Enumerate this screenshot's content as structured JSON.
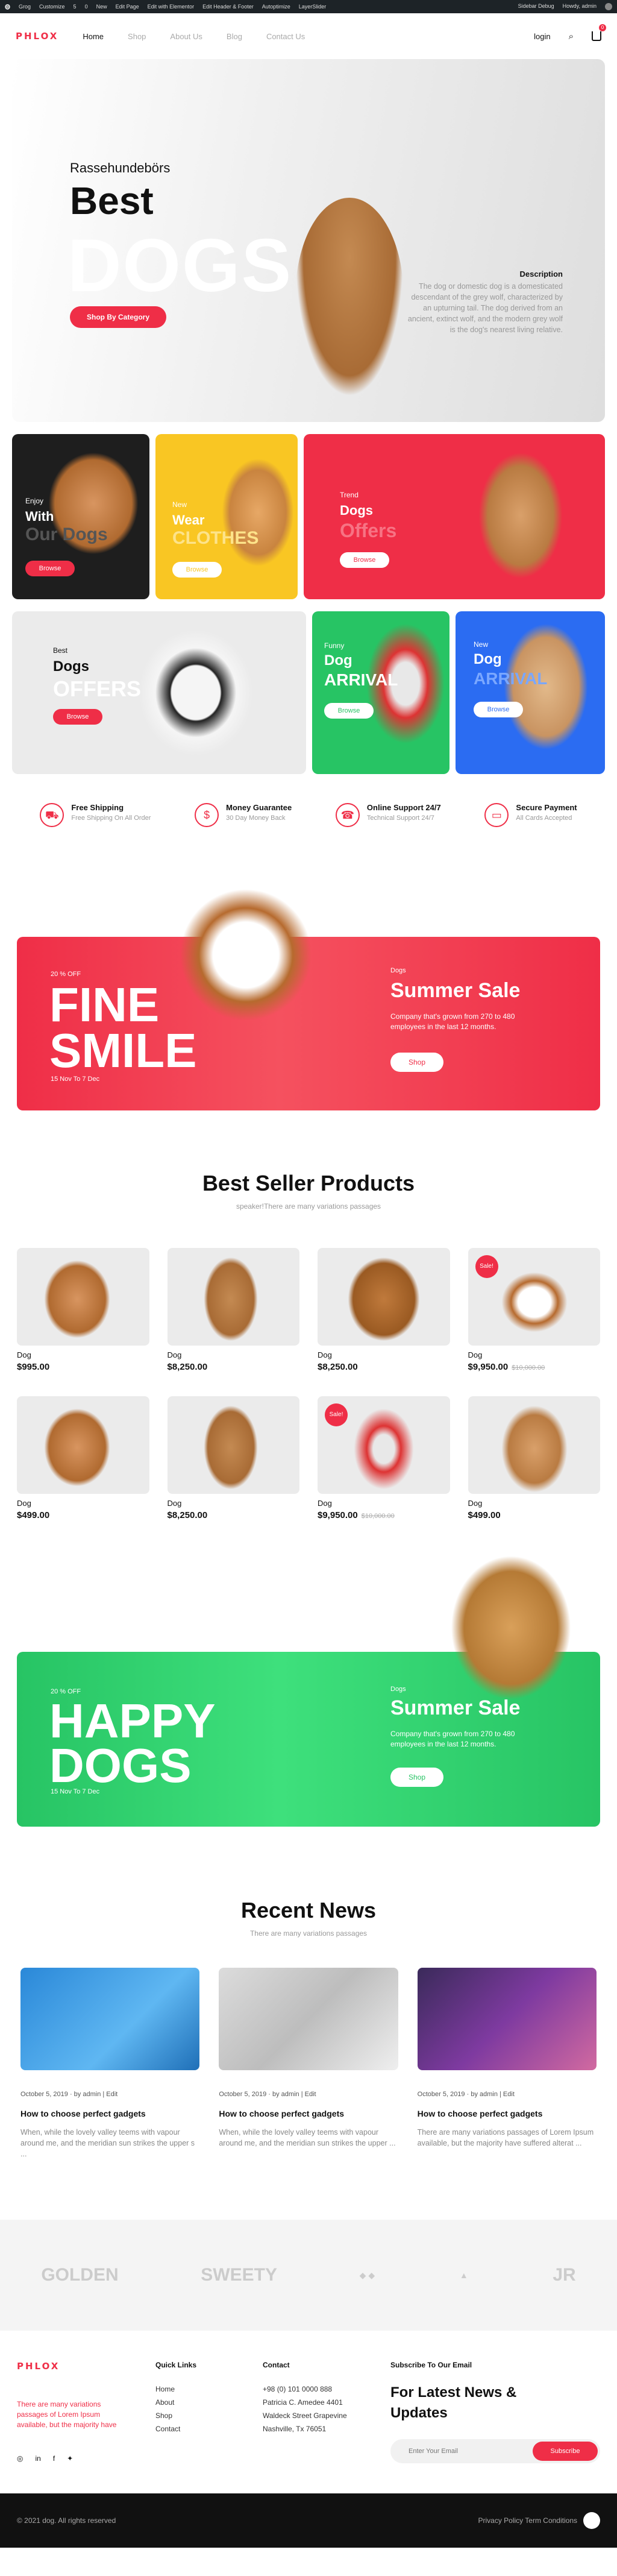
{
  "admin_bar": {
    "items": [
      "Grog",
      "Customize",
      "5",
      "0",
      "New",
      "Edit Page",
      "Edit with Elementor",
      "Edit Header & Footer",
      "Autoptimize",
      "LayerSlider"
    ],
    "right": [
      "Sidebar Debug",
      "Howdy, admin"
    ]
  },
  "header": {
    "logo": "PHLOX",
    "nav": [
      "Home",
      "Shop",
      "About Us",
      "Blog",
      "Contact Us"
    ],
    "login": "login",
    "cart_count": "0"
  },
  "hero": {
    "pretitle": "Rassehundebörs",
    "title": "Best",
    "big": "DOGS",
    "button": "Shop By Category",
    "desc_title": "Description",
    "desc": "The dog or domestic dog is a domesticated descendant of the grey wolf, characterized by an upturning tail. The dog derived from an ancient, extinct wolf, and the modern grey wolf is the dog's nearest living relative."
  },
  "cards_row1": [
    {
      "small": "Enjoy",
      "big": "With",
      "outline": "Our Dogs",
      "button": "Browse"
    },
    {
      "small": "New",
      "big": "Wear",
      "outline": "CLOTHES",
      "button": "Browse"
    },
    {
      "small": "Trend",
      "big": "Dogs",
      "outline": "Offers",
      "button": "Browse"
    }
  ],
  "cards_row2": [
    {
      "small": "Best",
      "big": "Dogs",
      "outline": "OFFERS",
      "button": "Browse"
    },
    {
      "small": "Funny",
      "big": "Dog",
      "outline": "ARRIVAL",
      "button": "Browse"
    },
    {
      "small": "New",
      "big": "Dog",
      "outline": "ARRIVAL",
      "button": "Browse"
    }
  ],
  "features": [
    {
      "title": "Free Shipping",
      "sub": "Free Shipping On All Order",
      "icon": "truck-icon"
    },
    {
      "title": "Money Guarantee",
      "sub": "30 Day Money Back",
      "icon": "money-icon"
    },
    {
      "title": "Online Support 24/7",
      "sub": "Technical Support 24/7",
      "icon": "headset-icon"
    },
    {
      "title": "Secure Payment",
      "sub": "All Cards Accepted",
      "icon": "card-icon"
    }
  ],
  "sale1": {
    "pct": "20 % OFF",
    "w1": "FINE",
    "w2": "SMILE",
    "date": "15 Nov To 7 Dec",
    "small": "Dogs",
    "title": "Summer Sale",
    "text": "Company that's grown from 270 to 480 employees in the last 12 months.",
    "button": "Shop"
  },
  "best": {
    "title": "Best Seller Products",
    "sub": "speaker!There are many variations passages"
  },
  "products": [
    {
      "name": "Dog",
      "price": "$995.00",
      "old": "",
      "badge": ""
    },
    {
      "name": "Dog",
      "price": "$8,250.00",
      "old": "",
      "badge": ""
    },
    {
      "name": "Dog",
      "price": "$8,250.00",
      "old": "",
      "badge": ""
    },
    {
      "name": "Dog",
      "price": "$9,950.00",
      "old": "$10,000.00",
      "badge": "Sale!"
    },
    {
      "name": "Dog",
      "price": "$499.00",
      "old": "",
      "badge": ""
    },
    {
      "name": "Dog",
      "price": "$8,250.00",
      "old": "",
      "badge": ""
    },
    {
      "name": "Dog",
      "price": "$9,950.00",
      "old": "$10,000.00",
      "badge": "Sale!"
    },
    {
      "name": "Dog",
      "price": "$499.00",
      "old": "",
      "badge": ""
    }
  ],
  "sale2": {
    "pct": "20 % OFF",
    "w1": "HAPPY",
    "w2": "DOGS",
    "date": "15 Nov To 7 Dec",
    "small": "Dogs",
    "title": "Summer Sale",
    "text": "Company that's grown from 270 to 480 employees in the last 12 months.",
    "button": "Shop"
  },
  "news": {
    "title": "Recent News",
    "sub": "There are many variations passages",
    "items": [
      {
        "date": "October 5, 2019",
        "by": "by admin | Edit",
        "title": "How to choose perfect gadgets",
        "text": "When, while the lovely valley teems with vapour around me, and the meridian sun strikes the upper s ..."
      },
      {
        "date": "October 5, 2019",
        "by": "by admin | Edit",
        "title": "How to choose perfect gadgets",
        "text": "When, while the lovely valley teems with vapour around me, and the meridian sun strikes the upper ..."
      },
      {
        "date": "October 5, 2019",
        "by": "by admin | Edit",
        "title": "How to choose perfect gadgets",
        "text": "There are many variations passages of Lorem Ipsum available, but the majority have suffered alterat ..."
      }
    ]
  },
  "brands": [
    "GOLDEN",
    "SWEETY",
    "",
    "",
    "JR"
  ],
  "footer": {
    "logo": "PHLOX",
    "about": "There are many variations passages of Lorem Ipsum available, but the majority have",
    "quick_title": "Quick Links",
    "links": [
      "Home",
      "About",
      "Shop",
      "Contact"
    ],
    "contact_title": "Contact",
    "contact": [
      "+98 (0) 101 0000 888",
      "Patricia C. Amedee 4401",
      "Waldeck Street Grapevine",
      "Nashville, Tx 76051"
    ],
    "sub_title": "Subscribe To Our Email",
    "news_head": "For Latest News & Updates",
    "email_ph": "Enter Your Email",
    "subscribe": "Subscribe"
  },
  "copyright": {
    "left": "© 2021 dog. All rights reserved",
    "right": "Privacy Policy    Term Conditions"
  }
}
